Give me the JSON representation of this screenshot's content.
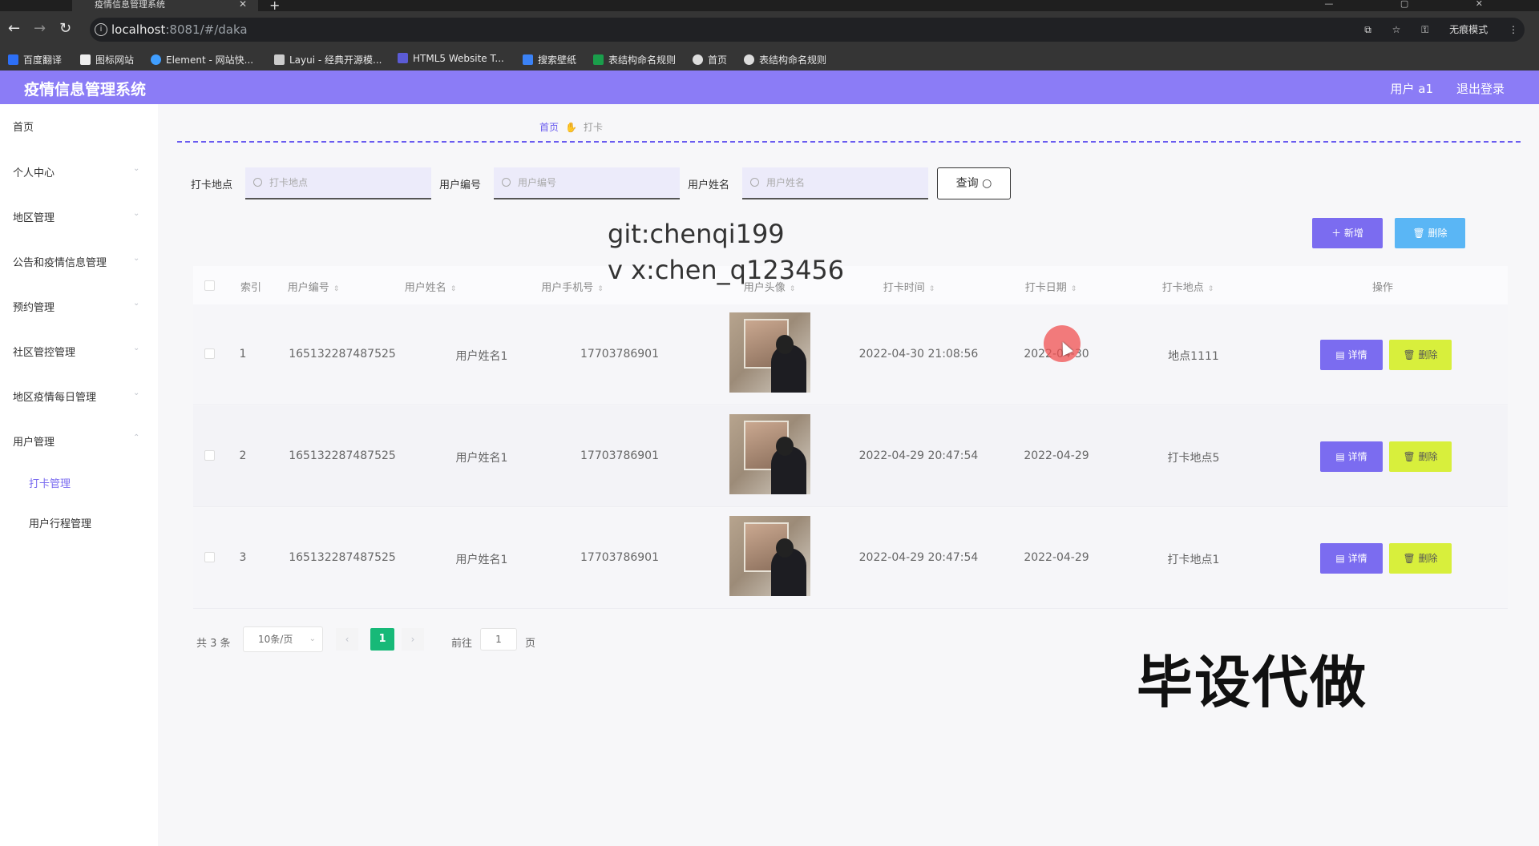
{
  "browser": {
    "tab_title": "疫情信息管理系统",
    "tab_close": "✕",
    "new_tab": "+",
    "url_host": "localhost",
    "url_path": ":8081/#/daka",
    "incognito_label": "无痕模式",
    "bookmarks": [
      "百度翻译",
      "图标网站",
      "Element - 网站快...",
      "Layui - 经典开源模...",
      "HTML5 Website T...",
      "搜索壁纸",
      "表结构命名规则",
      "首页",
      "表结构命名规则"
    ]
  },
  "header": {
    "title": "疫情信息管理系统",
    "user": "用户 a1",
    "logout": "退出登录",
    "accent_color": "#8b7cf6"
  },
  "sidebar": {
    "items": [
      {
        "label": "首页"
      },
      {
        "label": "个人中心"
      },
      {
        "label": "地区管理"
      },
      {
        "label": "公告和疫情信息管理"
      },
      {
        "label": "预约管理"
      },
      {
        "label": "社区管控管理"
      },
      {
        "label": "地区疫情每日管理"
      },
      {
        "label": "用户管理"
      }
    ],
    "sub_items": [
      {
        "label": "打卡管理"
      },
      {
        "label": "用户行程管理"
      }
    ]
  },
  "breadcrumb": {
    "home": "首页",
    "current": "打卡"
  },
  "search": {
    "location_label": "打卡地点",
    "location_placeholder": "打卡地点",
    "user_id_label": "用户编号",
    "user_id_placeholder": "用户编号",
    "user_name_label": "用户姓名",
    "user_name_placeholder": "用户姓名",
    "query_button": "查询 ○"
  },
  "actions": {
    "add": "＋ 新增",
    "delete": "🗑 删除"
  },
  "table": {
    "columns": [
      "索引",
      "用户编号",
      "用户姓名",
      "用户手机号",
      "用户头像",
      "打卡时间",
      "打卡日期",
      "打卡地点",
      "操作"
    ],
    "rows": [
      {
        "index": "1",
        "user_id": "165132287487525",
        "name": "用户姓名1",
        "phone": "17703786901",
        "time": "2022-04-30 21:08:56",
        "date": "2022-04-30",
        "place": "地点1111"
      },
      {
        "index": "2",
        "user_id": "165132287487525",
        "name": "用户姓名1",
        "phone": "17703786901",
        "time": "2022-04-29 20:47:54",
        "date": "2022-04-29",
        "place": "打卡地点5"
      },
      {
        "index": "3",
        "user_id": "165132287487525",
        "name": "用户姓名1",
        "phone": "17703786901",
        "time": "2022-04-29 20:47:54",
        "date": "2022-04-29",
        "place": "打卡地点1"
      }
    ],
    "detail_label": "▤ 详情",
    "delete_label": "🗑 删除"
  },
  "pagination": {
    "total": "共 3 条",
    "page_size": "10条/页",
    "current": "1",
    "goto_label": "前往",
    "goto_value": "1",
    "page_suffix": "页"
  },
  "overlay": {
    "watermark_line1": "git:chenqi199",
    "watermark_line2": "v x:chen_q123456",
    "big_text": "毕设代做"
  }
}
